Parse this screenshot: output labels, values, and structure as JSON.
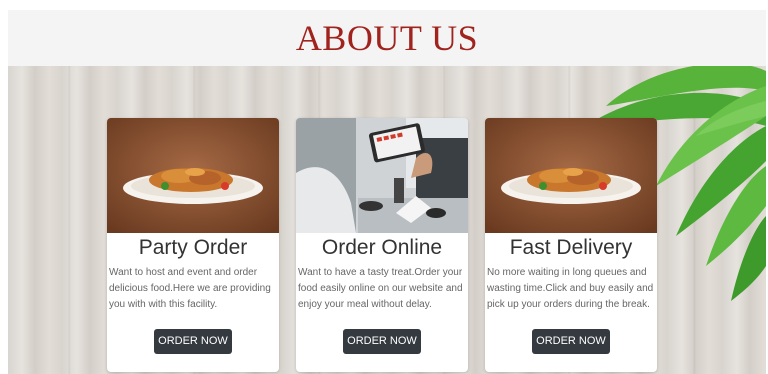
{
  "header": {
    "title": "ABOUT US"
  },
  "cards": [
    {
      "title": "Party Order",
      "text": "Want to host and event and order delicious food.Here we are providing you with with this facility.",
      "button": "ORDER NOW",
      "image": "food-plate-image"
    },
    {
      "title": "Order Online",
      "text": "Want to have a tasty treat.Order your food easily online on our website and enjoy your meal without delay.",
      "button": "ORDER NOW",
      "image": "tablet-ordering-image"
    },
    {
      "title": "Fast Delivery",
      "text": "No more waiting in long queues and wasting time.Click and buy easily and pick up your orders during the break.",
      "button": "ORDER NOW",
      "image": "food-plate-image"
    }
  ],
  "colors": {
    "title": "#a0231d",
    "button": "#343a40",
    "header_bg": "#f4f4f4"
  }
}
